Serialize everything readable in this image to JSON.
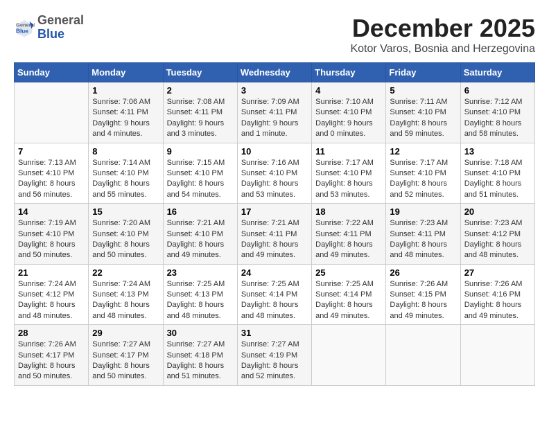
{
  "logo": {
    "general": "General",
    "blue": "Blue"
  },
  "header": {
    "month": "December 2025",
    "location": "Kotor Varos, Bosnia and Herzegovina"
  },
  "weekdays": [
    "Sunday",
    "Monday",
    "Tuesday",
    "Wednesday",
    "Thursday",
    "Friday",
    "Saturday"
  ],
  "weeks": [
    [
      {
        "day": "",
        "info": ""
      },
      {
        "day": "1",
        "info": "Sunrise: 7:06 AM\nSunset: 4:11 PM\nDaylight: 9 hours\nand 4 minutes."
      },
      {
        "day": "2",
        "info": "Sunrise: 7:08 AM\nSunset: 4:11 PM\nDaylight: 9 hours\nand 3 minutes."
      },
      {
        "day": "3",
        "info": "Sunrise: 7:09 AM\nSunset: 4:11 PM\nDaylight: 9 hours\nand 1 minute."
      },
      {
        "day": "4",
        "info": "Sunrise: 7:10 AM\nSunset: 4:10 PM\nDaylight: 9 hours\nand 0 minutes."
      },
      {
        "day": "5",
        "info": "Sunrise: 7:11 AM\nSunset: 4:10 PM\nDaylight: 8 hours\nand 59 minutes."
      },
      {
        "day": "6",
        "info": "Sunrise: 7:12 AM\nSunset: 4:10 PM\nDaylight: 8 hours\nand 58 minutes."
      }
    ],
    [
      {
        "day": "7",
        "info": "Sunrise: 7:13 AM\nSunset: 4:10 PM\nDaylight: 8 hours\nand 56 minutes."
      },
      {
        "day": "8",
        "info": "Sunrise: 7:14 AM\nSunset: 4:10 PM\nDaylight: 8 hours\nand 55 minutes."
      },
      {
        "day": "9",
        "info": "Sunrise: 7:15 AM\nSunset: 4:10 PM\nDaylight: 8 hours\nand 54 minutes."
      },
      {
        "day": "10",
        "info": "Sunrise: 7:16 AM\nSunset: 4:10 PM\nDaylight: 8 hours\nand 53 minutes."
      },
      {
        "day": "11",
        "info": "Sunrise: 7:17 AM\nSunset: 4:10 PM\nDaylight: 8 hours\nand 53 minutes."
      },
      {
        "day": "12",
        "info": "Sunrise: 7:17 AM\nSunset: 4:10 PM\nDaylight: 8 hours\nand 52 minutes."
      },
      {
        "day": "13",
        "info": "Sunrise: 7:18 AM\nSunset: 4:10 PM\nDaylight: 8 hours\nand 51 minutes."
      }
    ],
    [
      {
        "day": "14",
        "info": "Sunrise: 7:19 AM\nSunset: 4:10 PM\nDaylight: 8 hours\nand 50 minutes."
      },
      {
        "day": "15",
        "info": "Sunrise: 7:20 AM\nSunset: 4:10 PM\nDaylight: 8 hours\nand 50 minutes."
      },
      {
        "day": "16",
        "info": "Sunrise: 7:21 AM\nSunset: 4:10 PM\nDaylight: 8 hours\nand 49 minutes."
      },
      {
        "day": "17",
        "info": "Sunrise: 7:21 AM\nSunset: 4:11 PM\nDaylight: 8 hours\nand 49 minutes."
      },
      {
        "day": "18",
        "info": "Sunrise: 7:22 AM\nSunset: 4:11 PM\nDaylight: 8 hours\nand 49 minutes."
      },
      {
        "day": "19",
        "info": "Sunrise: 7:23 AM\nSunset: 4:11 PM\nDaylight: 8 hours\nand 48 minutes."
      },
      {
        "day": "20",
        "info": "Sunrise: 7:23 AM\nSunset: 4:12 PM\nDaylight: 8 hours\nand 48 minutes."
      }
    ],
    [
      {
        "day": "21",
        "info": "Sunrise: 7:24 AM\nSunset: 4:12 PM\nDaylight: 8 hours\nand 48 minutes."
      },
      {
        "day": "22",
        "info": "Sunrise: 7:24 AM\nSunset: 4:13 PM\nDaylight: 8 hours\nand 48 minutes."
      },
      {
        "day": "23",
        "info": "Sunrise: 7:25 AM\nSunset: 4:13 PM\nDaylight: 8 hours\nand 48 minutes."
      },
      {
        "day": "24",
        "info": "Sunrise: 7:25 AM\nSunset: 4:14 PM\nDaylight: 8 hours\nand 48 minutes."
      },
      {
        "day": "25",
        "info": "Sunrise: 7:25 AM\nSunset: 4:14 PM\nDaylight: 8 hours\nand 49 minutes."
      },
      {
        "day": "26",
        "info": "Sunrise: 7:26 AM\nSunset: 4:15 PM\nDaylight: 8 hours\nand 49 minutes."
      },
      {
        "day": "27",
        "info": "Sunrise: 7:26 AM\nSunset: 4:16 PM\nDaylight: 8 hours\nand 49 minutes."
      }
    ],
    [
      {
        "day": "28",
        "info": "Sunrise: 7:26 AM\nSunset: 4:17 PM\nDaylight: 8 hours\nand 50 minutes."
      },
      {
        "day": "29",
        "info": "Sunrise: 7:27 AM\nSunset: 4:17 PM\nDaylight: 8 hours\nand 50 minutes."
      },
      {
        "day": "30",
        "info": "Sunrise: 7:27 AM\nSunset: 4:18 PM\nDaylight: 8 hours\nand 51 minutes."
      },
      {
        "day": "31",
        "info": "Sunrise: 7:27 AM\nSunset: 4:19 PM\nDaylight: 8 hours\nand 52 minutes."
      },
      {
        "day": "",
        "info": ""
      },
      {
        "day": "",
        "info": ""
      },
      {
        "day": "",
        "info": ""
      }
    ]
  ]
}
